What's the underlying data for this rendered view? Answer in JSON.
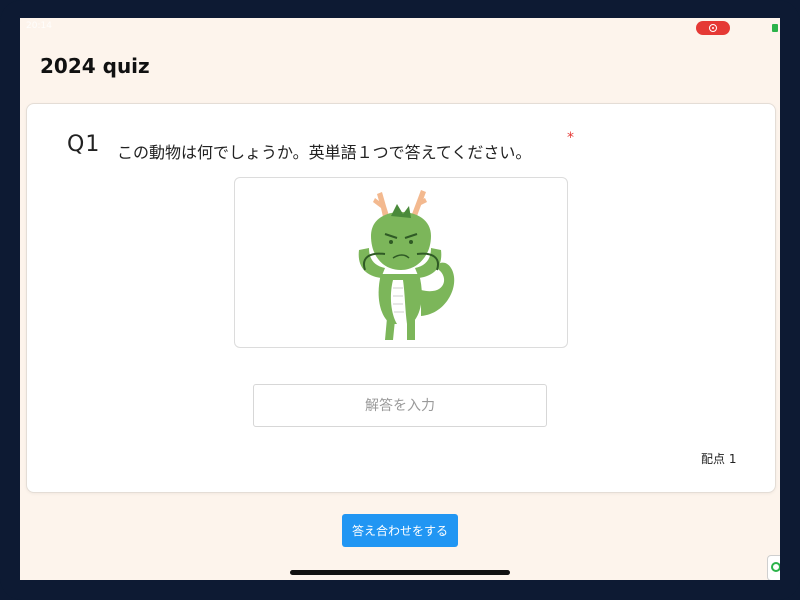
{
  "status": {
    "time": "20:14"
  },
  "page": {
    "title": "2024 quiz"
  },
  "question": {
    "number": "Q1",
    "text": "この動物は何でしょうか。英単語１つで答えてください。",
    "required_mark": "*",
    "image_icon": "dragon-illustration"
  },
  "answer": {
    "placeholder": "解答を入力",
    "value": ""
  },
  "score": {
    "label": "配点 1"
  },
  "submit": {
    "label": "答え合わせをする"
  },
  "colors": {
    "accent": "#2196f3",
    "required": "#e53935",
    "background": "#fdf4ec",
    "dragon_body": "#7cb65a",
    "dragon_horn": "#f3b98f"
  }
}
